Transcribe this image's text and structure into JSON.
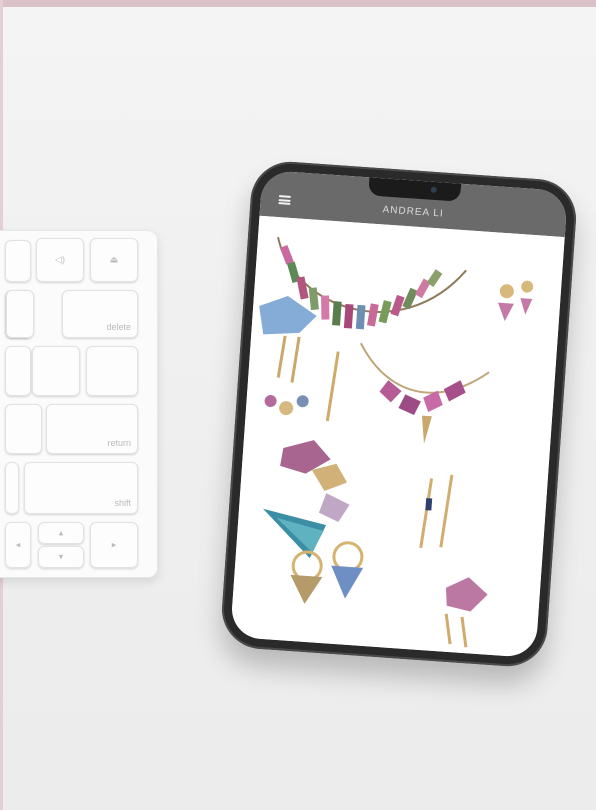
{
  "app": {
    "brand_title": "ANDREA LI"
  },
  "keyboard": {
    "keys": [
      "delete",
      "return",
      "shift"
    ]
  },
  "colors": {
    "accent_top": "#d9c3c8",
    "header_gray": "#6a6a6a"
  }
}
